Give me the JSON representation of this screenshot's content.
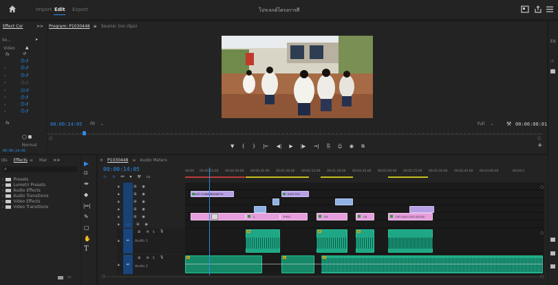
{
  "topbar": {
    "home_label": "⌂",
    "tabs": [
      {
        "label": "Import",
        "active": false
      },
      {
        "label": "Edit",
        "active": true
      },
      {
        "label": "Export",
        "active": false
      }
    ],
    "project_title": "โปรเจกต์โครงการศึ"
  },
  "program_monitor": {
    "tab_left": "Effect Cor",
    "expand": ">>",
    "tab_program": "Program: P1030448",
    "menu": "≡",
    "tab_source": "Source: (no clips)",
    "timecode": "00:00:14:05",
    "fit_label": "Fit",
    "quality_label": "Full",
    "duration": "00:00:00:01",
    "transport": [
      "▼",
      "{",
      "}",
      "|←",
      "◀|",
      "▶",
      "|▶",
      "→|",
      "⎘",
      "⎙",
      "◉",
      "⧉"
    ],
    "add_button": "+"
  },
  "effect_controls": {
    "source_label": "So...",
    "video_label": "Video",
    "fx_label": "fx",
    "normal_label": "Normal",
    "timecode": "00:00:14:05"
  },
  "effects_panel": {
    "tabs": [
      {
        "label": "lds",
        "active": false
      },
      {
        "label": "Effects",
        "active": true
      },
      {
        "label": "≡",
        "active": false
      },
      {
        "label": "Mar",
        "active": false
      },
      {
        "label": ">>",
        "active": false
      }
    ],
    "search_icon": "⌕",
    "items": [
      "Presets",
      "Lumetri Presets",
      "Audio Effects",
      "Audio Transitions",
      "Video Effects",
      "Video Transitions"
    ]
  },
  "timeline": {
    "tab_sequence": "P1030448",
    "tab_menu": "≡",
    "tab_audio": "Audio Meters",
    "close_x": "×",
    "timecode": "00:00:14:05",
    "ruler": [
      "00:00",
      "00:00:15:00",
      "00:00:30:00",
      "00:00:45:00",
      "00:01:00:00",
      "00:01:15:00",
      "00:01:30:00",
      "00:01:45:00",
      "00:02:00:00",
      "00:02:15:00",
      "00:02:30:00",
      "00:02:45:00",
      "00:03:00:00",
      "00:03:1"
    ],
    "tracks": [
      {
        "name": "V6"
      },
      {
        "name": "V5"
      },
      {
        "name": "V4"
      },
      {
        "name": "V3"
      },
      {
        "name": "V2"
      },
      {
        "name": "V1"
      }
    ],
    "audio_tracks": [
      {
        "name": "A1",
        "label": "Audio 1",
        "m": "M",
        "s": "S"
      },
      {
        "name": "A2",
        "label": "Audio 2",
        "m": "M",
        "s": "S"
      }
    ],
    "clip_labels": {
      "v5_clip": "DLI07 S7ABB28B1ME731",
      "v5_clip2": "ELI07 S74",
      "v1_a": "C",
      "v1_b": "P",
      "v1_c": "PLO",
      "v1_d": "CH",
      "v1_e": "CH",
      "v1_f": "CH7 2014 1231 021134",
      "a_fx": "fx"
    }
  },
  "tools": [
    "▶",
    "⇹",
    "✎",
    "⧖",
    "✚",
    "✋",
    "T"
  ],
  "colors": {
    "accent": "#2d8ceb",
    "playhead": "#2d8ceb",
    "video_clip": "#e59fdc",
    "audio_clip": "#1fa785",
    "video_blue": "#8fb2e6",
    "bar_red": "#c23b3b",
    "bar_yellow": "#c9c21c"
  }
}
